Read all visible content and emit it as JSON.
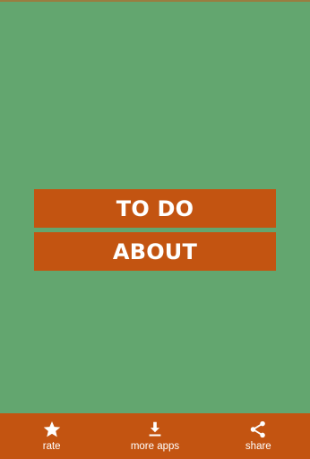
{
  "menu": {
    "todo_label": "TO DO",
    "about_label": "ABOUT"
  },
  "bottom_bar": {
    "items": [
      {
        "label": "rate",
        "icon": "star-icon"
      },
      {
        "label": "more apps",
        "icon": "download-icon"
      },
      {
        "label": "share",
        "icon": "share-icon"
      }
    ]
  },
  "colors": {
    "background": "#63a66f",
    "accent": "#c35411",
    "text": "#ffffff"
  }
}
